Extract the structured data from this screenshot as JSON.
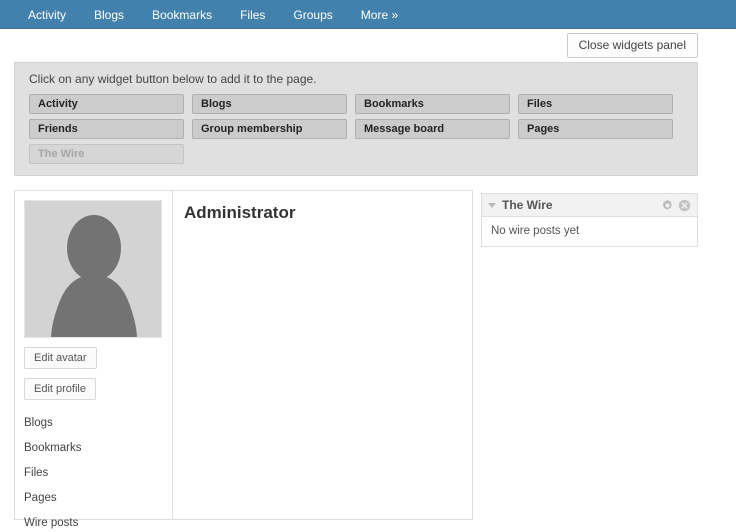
{
  "topnav": {
    "items": [
      {
        "label": "Activity",
        "name": "nav-activity"
      },
      {
        "label": "Blogs",
        "name": "nav-blogs"
      },
      {
        "label": "Bookmarks",
        "name": "nav-bookmarks"
      },
      {
        "label": "Files",
        "name": "nav-files"
      },
      {
        "label": "Groups",
        "name": "nav-groups"
      },
      {
        "label": "More »",
        "name": "nav-more"
      }
    ],
    "background_color": "#4281ab",
    "text_color": "#ffffff"
  },
  "toolbar": {
    "close_widgets_label": "Close widgets panel"
  },
  "widgets_panel": {
    "hint": "Click on any widget button below to add it to the page.",
    "background_color": "#e0e0e0",
    "buttons": [
      {
        "label": "Activity",
        "disabled": false
      },
      {
        "label": "Blogs",
        "disabled": false
      },
      {
        "label": "Bookmarks",
        "disabled": false
      },
      {
        "label": "Files",
        "disabled": false
      },
      {
        "label": "Friends",
        "disabled": false
      },
      {
        "label": "Group membership",
        "disabled": false
      },
      {
        "label": "Message board",
        "disabled": false
      },
      {
        "label": "Pages",
        "disabled": false
      },
      {
        "label": "The Wire",
        "disabled": true
      }
    ]
  },
  "profile": {
    "avatar_alt": "default-avatar-silhouette",
    "edit_avatar_label": "Edit avatar",
    "edit_profile_label": "Edit profile",
    "links": [
      {
        "label": "Blogs"
      },
      {
        "label": "Bookmarks"
      },
      {
        "label": "Files"
      },
      {
        "label": "Pages"
      },
      {
        "label": "Wire posts"
      }
    ]
  },
  "main": {
    "title": "Administrator"
  },
  "widget_column": {
    "widgets": [
      {
        "title": "The Wire",
        "body": "No wire posts yet"
      }
    ]
  }
}
